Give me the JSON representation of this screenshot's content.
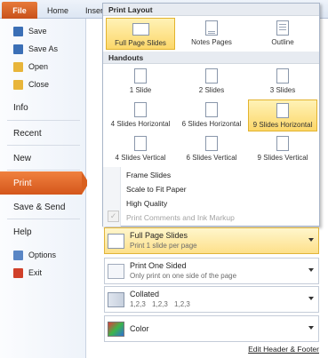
{
  "ribbon": {
    "file_label": "File",
    "tabs": [
      "Home",
      "Insert"
    ]
  },
  "nav": {
    "items": [
      {
        "label": "Save",
        "icon": "save-icon",
        "color": "#3b6fb6"
      },
      {
        "label": "Save As",
        "icon": "save-as-icon",
        "color": "#3b6fb6"
      },
      {
        "label": "Open",
        "icon": "open-folder-icon",
        "color": "#e8b53a"
      },
      {
        "label": "Close",
        "icon": "close-folder-icon",
        "color": "#e8b53a"
      },
      {
        "label": "Info"
      },
      {
        "label": "Recent"
      },
      {
        "label": "New"
      },
      {
        "label": "Print"
      },
      {
        "label": "Save & Send"
      },
      {
        "label": "Help"
      },
      {
        "label": "Options",
        "icon": "options-icon",
        "color": "#5a86c5"
      },
      {
        "label": "Exit",
        "icon": "exit-icon",
        "color": "#d0402a"
      }
    ]
  },
  "dropdown": {
    "print_layout_header": "Print Layout",
    "print_layout_options": [
      "Full Page Slides",
      "Notes Pages",
      "Outline"
    ],
    "handouts_header": "Handouts",
    "handout_options": [
      "1 Slide",
      "2 Slides",
      "3 Slides",
      "4 Slides Horizontal",
      "6 Slides Horizontal",
      "9 Slides Horizontal",
      "4 Slides Vertical",
      "6 Slides Vertical",
      "9 Slides Vertical"
    ],
    "menu": [
      "Frame Slides",
      "Scale to Fit Paper",
      "High Quality",
      "Print Comments and Ink Markup"
    ]
  },
  "settings": {
    "layout": {
      "title": "Full Page Slides",
      "subtitle": "Print 1 slide per page"
    },
    "sided": {
      "title": "Print One Sided",
      "subtitle": "Only print on one side of the page"
    },
    "collated": {
      "title": "Collated",
      "subtitle": "1,2,3 1,2,3 1,2,3"
    },
    "color": {
      "title": "Color"
    }
  },
  "footer_link": "Edit Header & Footer",
  "colors": {
    "accent": "#d4561b",
    "highlight": "#fcd76a"
  }
}
